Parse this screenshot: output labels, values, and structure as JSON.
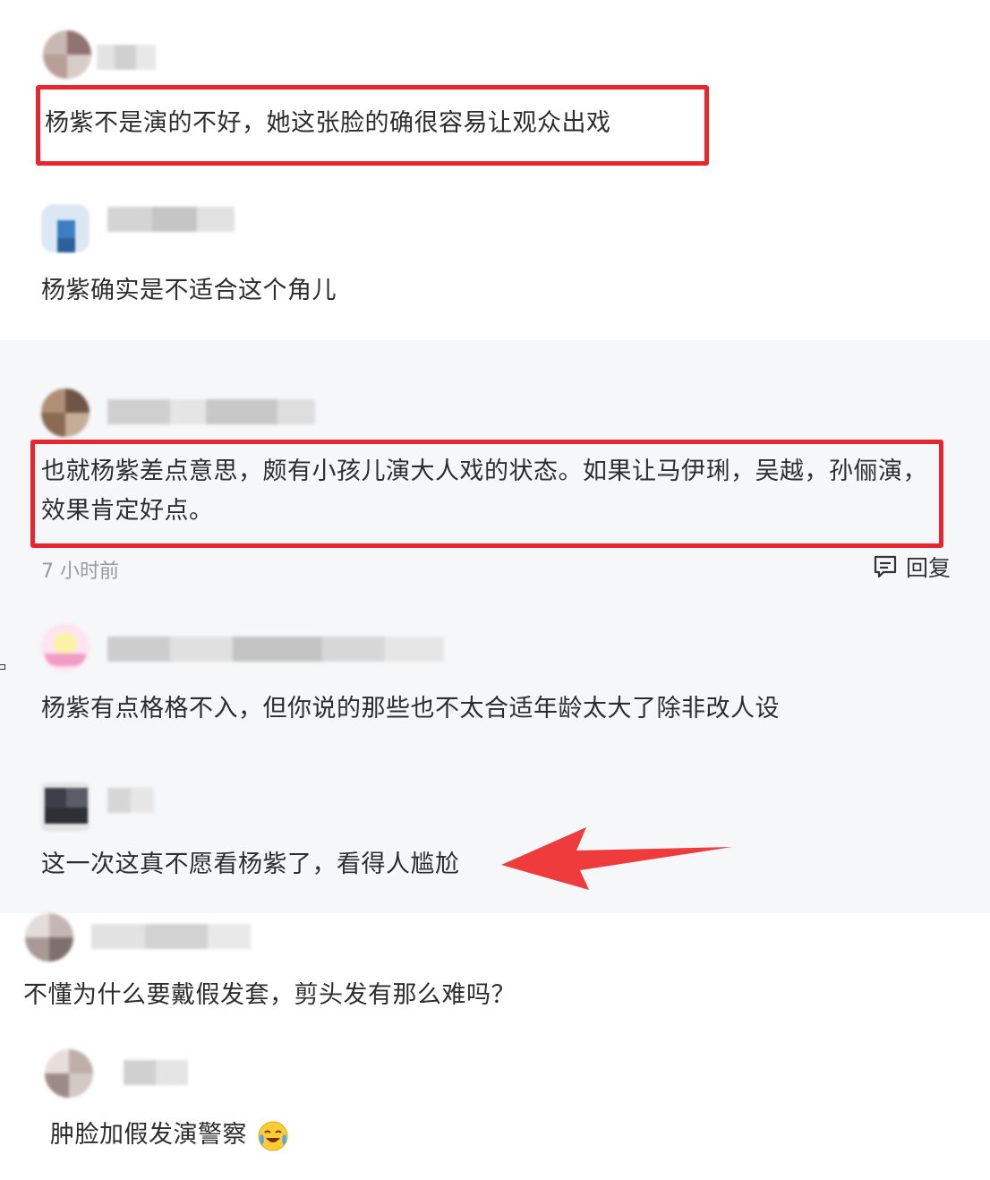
{
  "comments": [
    {
      "text": "杨紫不是演的不好，她这张脸的确很容易让观众出戏",
      "highlighted": true,
      "avatar_color": "#a58a80",
      "name_blurred": true
    },
    {
      "text": "杨紫确实是不适合这个角儿",
      "highlighted": false,
      "avatar_color": "#3b7fc0",
      "name_blurred": true
    },
    {
      "text": "也就杨紫差点意思，颇有小孩儿演大人戏的状态。如果让马伊琍，吴越，孙俪演，效果肯定好点。",
      "highlighted": true,
      "avatar_color": "#8a6b52",
      "name_blurred": true,
      "time": "7 小时前",
      "reply_label": "回复"
    },
    {
      "text": "杨紫有点格格不入，但你说的那些也不太合适年龄太大了除非改人设",
      "highlighted": false,
      "avatar_color": "#f5b8d8",
      "name_blurred": true
    },
    {
      "text": "这一次这真不愿看杨紫了，看得人尴尬",
      "highlighted": false,
      "avatar_color": "#3d3f48",
      "name_blurred": true,
      "annotated_with_arrow": true
    },
    {
      "text": "不懂为什么要戴假发套，剪头发有那么难吗？",
      "highlighted": false,
      "avatar_color": "#a89a96",
      "name_blurred": true
    },
    {
      "text": "肿脸加假发演警察",
      "highlighted": false,
      "avatar_color": "#9c8a86",
      "name_blurred": true,
      "trailing_emoji": "crying-laughing-emoji-icon"
    }
  ],
  "colors": {
    "highlight_red": "#e8262f",
    "arrow_red": "#ef3b3b",
    "text": "#2d2d2d",
    "meta": "#9a9a9a",
    "mid_band_bg": "#f6f7f9"
  }
}
